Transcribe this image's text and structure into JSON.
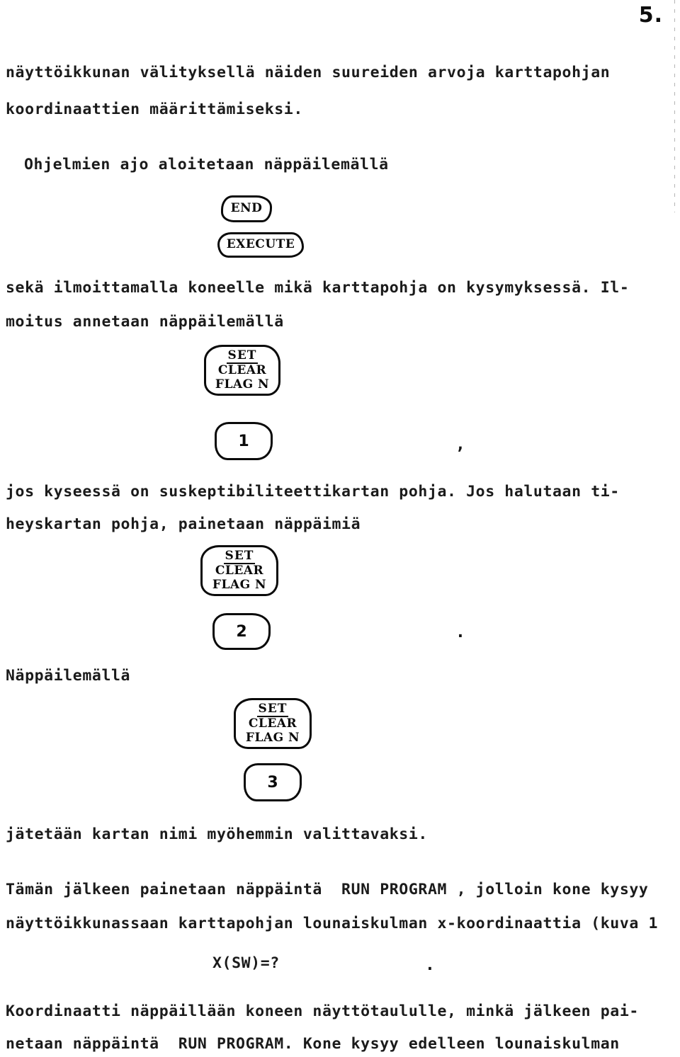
{
  "page": {
    "number": "5.",
    "language": "fi"
  },
  "body": {
    "para1": [
      "näyttöikkunan välityksellä näiden suureiden arvoja karttapohjan",
      "koordinaattien määrittämiseksi."
    ],
    "para2": [
      "Ohjelmien ajo aloitetaan näppäilemällä"
    ],
    "para3": [
      "sekä ilmoittamalla koneelle mikä karttapohja on kysymyksessä. Il-",
      "moitus annetaan näppäilemällä"
    ],
    "para4": [
      "jos kyseessä on suskeptibiliteettikartan pohja. Jos halutaan ti-",
      "heyskartan pohja, painetaan näppäimiä"
    ],
    "para5": [
      "Näppäilemällä"
    ],
    "para6": [
      "jätetään kartan nimi myöhemmin valittavaksi."
    ],
    "para7": [
      "Tämän jälkeen painetaan näppäintä  RUN PROGRAM , jolloin kone kysyy",
      "näyttöikkunassaan karttapohjan lounaiskulman x-koordinaattia (kuva 1"
    ],
    "prompt": "X(SW)=?",
    "para8": [
      "Koordinaatti näppäillään koneen näyttötaululle, minkä jälkeen pai-",
      "netaan näppäintä  RUN PROGRAM. Kone kysyy edelleen lounaiskulman"
    ]
  },
  "floating_punctuation": {
    "comma_after_key1": ",",
    "period_after_key2": ".",
    "period_after_prompt": "."
  },
  "keys": {
    "end": {
      "label": "END"
    },
    "execute": {
      "label": "EXECUTE"
    },
    "flag": {
      "numerator": "SET",
      "denominator": "CLEAR",
      "flag_line": "FLAG N"
    },
    "digit_1": "1",
    "digit_2": "2",
    "digit_3": "3"
  },
  "colors": {
    "ink": "#0a0a0a",
    "paper": "#ffffff"
  }
}
